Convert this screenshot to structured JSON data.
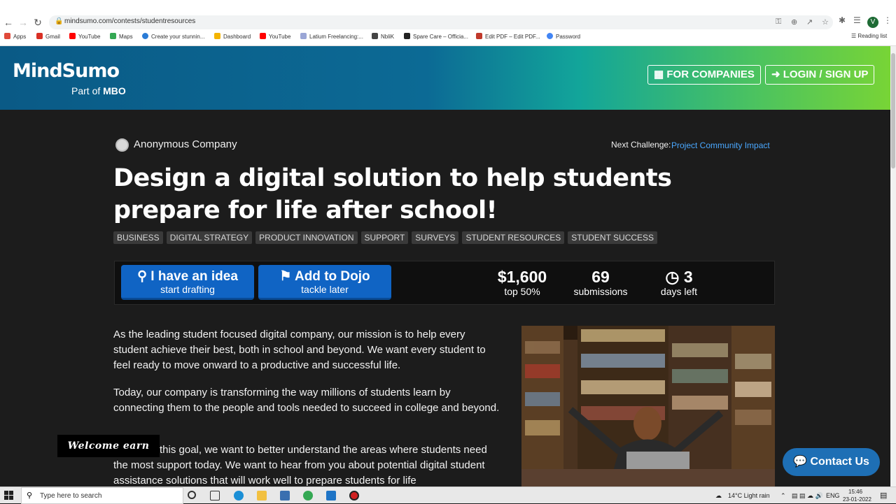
{
  "browser": {
    "url": "mindsumo.com/contests/studentresources",
    "bookmarks": [
      "Apps",
      "Gmail",
      "YouTube",
      "Maps",
      "Create your stunnin...",
      "Dashboard",
      "YouTube",
      "Latium Freelancing:...",
      "NbliK",
      "Spare Care – Officia...",
      "Edit PDF – Edit PDF...",
      "Password"
    ],
    "reading_list": "Reading list",
    "profile_initial": "V"
  },
  "header": {
    "logo": "MindSumo",
    "logo_sub_prefix": "Part of",
    "logo_sub_brand": "MBO",
    "for_companies": "FOR COMPANIES",
    "login": "LOGIN / SIGN UP"
  },
  "challenge": {
    "company": "Anonymous Company",
    "next_label": "Next Challenge:",
    "next_link": "Project Community Impact",
    "title": "Design a digital solution to help students prepare for life after school!",
    "tags": [
      "BUSINESS",
      "DIGITAL STRATEGY",
      "PRODUCT INNOVATION",
      "SUPPORT",
      "SURVEYS",
      "STUDENT RESOURCES",
      "STUDENT SUCCESS"
    ]
  },
  "actions": {
    "idea_main": "I have an idea",
    "idea_sub": "start drafting",
    "dojo_main": "Add to Dojo",
    "dojo_sub": "tackle later"
  },
  "stats": {
    "prize": "$1,600",
    "prize_label": "top 50%",
    "submissions": "69",
    "submissions_label": "submissions",
    "days": "3",
    "days_label": "days left"
  },
  "body": {
    "p1": "As the leading student focused digital company, our mission is to help every student achieve their best, both in school and beyond. We want every student to feel ready to move onward to a productive and successful life.",
    "p2": "Today, our company is transforming the way millions of students learn by connecting them to the people and tools needed to succeed in college and beyond.",
    "p3": "this goal, we want to better understand the areas where students need the most support today.  We want to hear from you about potential digital student assistance solutions that will work well to prepare students for life"
  },
  "overlay": {
    "welcome": "Welcome earn",
    "contact": "Contact Us"
  },
  "taskbar": {
    "search_placeholder": "Type here to search",
    "weather": "14°C  Light rain",
    "lang": "ENG",
    "time": "15:46",
    "date": "23-01-2022"
  },
  "colors": {
    "page_bg": "#1c1c1c",
    "accent_blue": "#1064c4",
    "link_blue": "#4aa8ff",
    "header_left": "#0a5a86",
    "header_right": "#78d436"
  }
}
